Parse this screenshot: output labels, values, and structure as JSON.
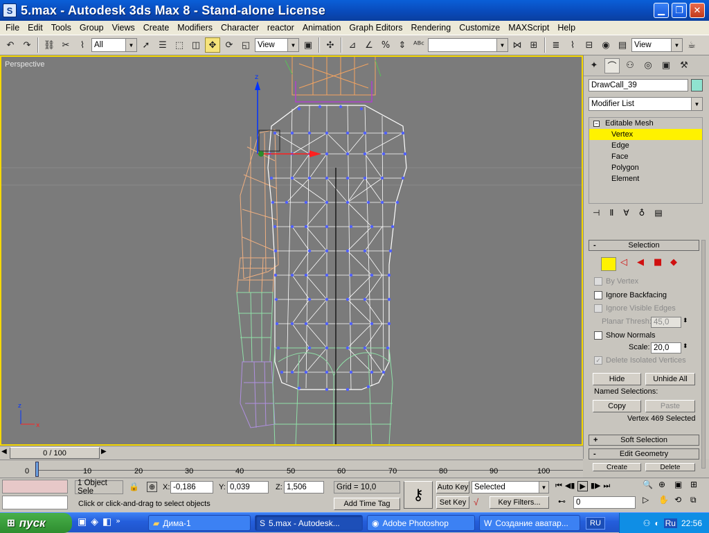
{
  "window": {
    "title": "5.max - Autodesk 3ds Max 8  - Stand-alone License",
    "app_icon": "3dsmax-icon"
  },
  "menu": [
    "File",
    "Edit",
    "Tools",
    "Group",
    "Views",
    "Create",
    "Modifiers",
    "Character",
    "reactor",
    "Animation",
    "Graph Editors",
    "Rendering",
    "Customize",
    "MAXScript",
    "Help"
  ],
  "toolbar": {
    "selection_filter": "All",
    "ref_coord": "View",
    "named_sel": "",
    "right_view": "View"
  },
  "viewport": {
    "label": "Perspective",
    "axis_labels": {
      "z": "z",
      "x": "x"
    }
  },
  "cmdpanel": {
    "object_name": "DrawCall_39",
    "object_color": "#8fe3d0",
    "modifier_list": "Modifier List",
    "stack": {
      "root": "Editable Mesh",
      "items": [
        "Vertex",
        "Edge",
        "Face",
        "Polygon",
        "Element"
      ],
      "selected": "Vertex"
    },
    "selection": {
      "title": "Selection",
      "by_vertex": "By Vertex",
      "ignore_backfacing": "Ignore Backfacing",
      "ignore_visible_edges": "Ignore Visible Edges",
      "planar_thresh_label": "Planar Thresh:",
      "planar_thresh_value": "45,0",
      "show_normals": "Show Normals",
      "scale_label": "Scale:",
      "scale_value": "20,0",
      "delete_isolated": "Delete Isolated Vertices",
      "hide": "Hide",
      "unhide_all": "Unhide All",
      "named_selections": "Named Selections:",
      "copy": "Copy",
      "paste": "Paste",
      "status": "Vertex 469 Selected"
    },
    "soft_selection": "Soft Selection",
    "edit_geometry": "Edit Geometry",
    "create": "Create",
    "delete": "Delete"
  },
  "timeline": {
    "slider": "0 / 100",
    "ticks": [
      "0",
      "10",
      "20",
      "30",
      "40",
      "50",
      "60",
      "70",
      "80",
      "90",
      "100"
    ]
  },
  "status": {
    "object_count": "1 Object Sele",
    "prompt": "Click or click-and-drag to select objects",
    "x_label": "X:",
    "x": "-0,186",
    "y_label": "Y:",
    "y": "0,039",
    "z_label": "Z:",
    "z": "1,506",
    "grid": "Grid = 10,0",
    "add_time_tag": "Add Time Tag",
    "auto_key": "Auto Key",
    "set_key": "Set Key",
    "key_mode": "Selected",
    "key_filters": "Key Filters...",
    "frame": "0"
  },
  "taskbar": {
    "start": "пуск",
    "tasks": [
      {
        "label": "Дима-1",
        "icon": "folder-icon"
      },
      {
        "label": "5.max - Autodesk...",
        "icon": "3dsmax-icon"
      },
      {
        "label": "Adobe Photoshop",
        "icon": "photoshop-icon"
      },
      {
        "label": "Создание аватар...",
        "icon": "word-icon"
      }
    ],
    "lang": "RU",
    "tray_lang": "Ru",
    "clock": "22:56"
  }
}
